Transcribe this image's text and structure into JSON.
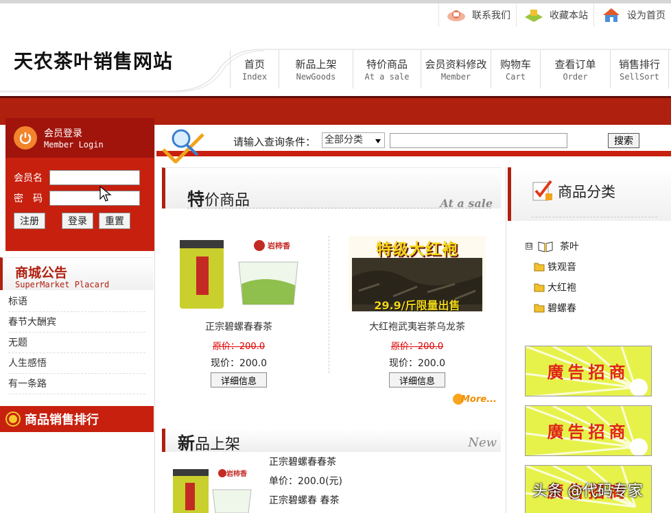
{
  "top_links": [
    {
      "label": "联系我们",
      "icon": "contact-icon"
    },
    {
      "label": "收藏本站",
      "icon": "bookmark-icon"
    },
    {
      "label": "设为首页",
      "icon": "home-icon"
    }
  ],
  "site_title": "天农茶叶销售网站",
  "nav": [
    {
      "cn": "首页",
      "en": "Index"
    },
    {
      "cn": "新品上架",
      "en": "NewGoods"
    },
    {
      "cn": "特价商品",
      "en": "At a sale"
    },
    {
      "cn": "会员资料修改",
      "en": "Member"
    },
    {
      "cn": "购物车",
      "en": "Cart"
    },
    {
      "cn": "查看订单",
      "en": "Order"
    },
    {
      "cn": "销售排行",
      "en": "SellSort"
    }
  ],
  "login": {
    "title": "会员登录",
    "subtitle": "Member Login",
    "username_label": "会员名",
    "password_label": "密　码",
    "register": "注册",
    "login": "登录",
    "reset": "重置"
  },
  "notice": {
    "title": "商城公告",
    "subtitle": "SuperMarket Placard",
    "items": [
      "标语",
      "春节大酬宾",
      "无题",
      "人生感悟",
      "有一条路"
    ]
  },
  "rank_title": "商品销售排行",
  "search": {
    "label": "请输入查询条件：",
    "category": "全部分类",
    "button": "搜索"
  },
  "sale": {
    "title_bold": "特",
    "title_rest": "价商品",
    "en": "At a sale",
    "products": [
      {
        "name": "正宗碧螺春春茶",
        "orig": "原价：200.0",
        "now": "现价：200.0",
        "detail": "详细信息",
        "brand": "岩柿香"
      },
      {
        "name": "大红袍武夷岩茶乌龙茶",
        "orig": "原价：200.0",
        "now": "现价：200.0",
        "detail": "详细信息",
        "banner_top": "特级大红袍",
        "banner_bottom": "29.9/斤限量出售"
      }
    ],
    "more": "More..."
  },
  "new_goods": {
    "title_bold": "新",
    "title_rest": "品上架",
    "en": "New",
    "name": "正宗碧螺春春茶",
    "price": "单价：200.0(元)",
    "desc": "正宗碧螺春 春茶",
    "brand": "岩柿香"
  },
  "category": {
    "title": "商品分类",
    "root": "茶叶",
    "toggle": "⊟",
    "children": [
      "铁观音",
      "大红袍",
      "碧螺春"
    ]
  },
  "ads": [
    "廣告招商",
    "廣告招商",
    "廣告招商"
  ],
  "watermark": "头条 @代码专家",
  "colors": {
    "brand_red": "#c7200f",
    "dark_red": "#a0140c",
    "ad_yellow": "#e6f24a"
  }
}
